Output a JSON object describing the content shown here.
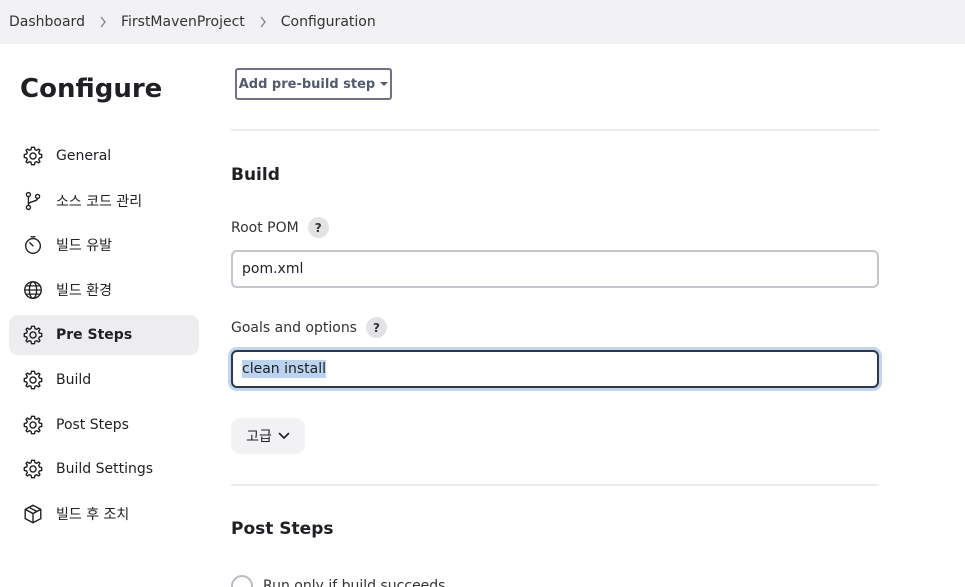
{
  "breadcrumb": {
    "items": [
      "Dashboard",
      "FirstMavenProject",
      "Configuration"
    ],
    "separator_icon": "chevron-right-icon"
  },
  "sidebar": {
    "title": "Configure",
    "items": [
      {
        "label": "General",
        "icon": "gear-icon",
        "active": false
      },
      {
        "label": "소스 코드 관리",
        "icon": "branch-icon",
        "active": false
      },
      {
        "label": "빌드 유발",
        "icon": "timer-icon",
        "active": false
      },
      {
        "label": "빌드 환경",
        "icon": "globe-icon",
        "active": false
      },
      {
        "label": "Pre Steps",
        "icon": "gear-icon",
        "active": true
      },
      {
        "label": "Build",
        "icon": "gear-icon",
        "active": false
      },
      {
        "label": "Post Steps",
        "icon": "gear-icon",
        "active": false
      },
      {
        "label": "Build Settings",
        "icon": "gear-icon",
        "active": false
      },
      {
        "label": "빌드 후 조치",
        "icon": "package-icon",
        "active": false
      }
    ]
  },
  "pre_steps": {
    "add_button_label": "Add pre-build step"
  },
  "build": {
    "title": "Build",
    "root_pom_label": "Root POM",
    "root_pom_value": "pom.xml",
    "goals_label": "Goals and options",
    "goals_value": "clean install",
    "help_label": "?",
    "advanced_label": "고급"
  },
  "post_steps": {
    "title": "Post Steps",
    "radio_label": "Run only if build succeeds"
  },
  "colors": {
    "breadcrumb_bg": "#f2f2f4",
    "active_item_bg": "#ededf0",
    "focus_ring": "#bfd6ee",
    "selection": "#bcd3ef"
  }
}
